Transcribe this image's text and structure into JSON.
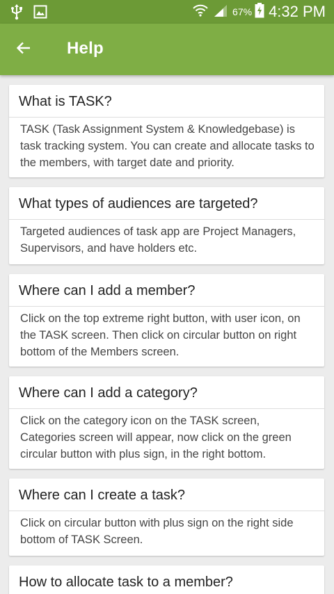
{
  "status_bar": {
    "battery_percent": "67%",
    "time": "4:32 PM"
  },
  "app_bar": {
    "title": "Help"
  },
  "faq": [
    {
      "question": "What is TASK?",
      "answer": "TASK (Task Assignment System & Knowledgebase) is task tracking system. You can create and allocate tasks to the members, with target date and priority."
    },
    {
      "question": "What types of audiences are targeted?",
      "answer": "Targeted audiences of task app are Project Managers, Supervisors, and have holders etc."
    },
    {
      "question": "Where can I add a member?",
      "answer": "Click on the top extreme right button, with user icon, on the TASK screen. Then click on circular button on right bottom of the Members screen."
    },
    {
      "question": "Where can I add a category?",
      "answer": "Click on the category icon on the TASK screen, Categories screen will appear, now click on the green circular button with plus sign, in the right bottom."
    },
    {
      "question": "Where can I create a task?",
      "answer": "Click on circular button with plus sign on the right side bottom of TASK Screen."
    },
    {
      "question": "How to allocate task to a member?",
      "answer": ""
    }
  ],
  "colors": {
    "status_bar": "#6c9a36",
    "app_bar": "#7fae45",
    "background": "#ececec"
  }
}
